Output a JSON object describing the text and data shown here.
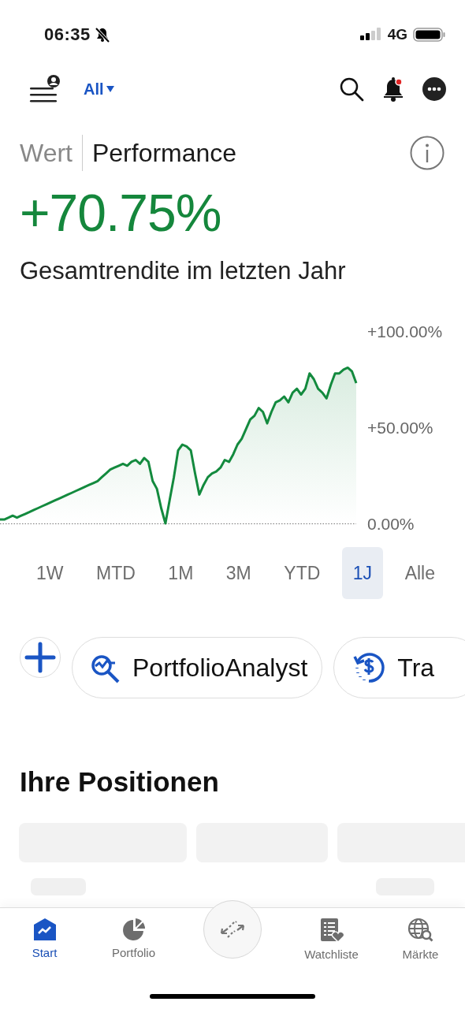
{
  "status_bar": {
    "time": "06:35",
    "network": "4G"
  },
  "header": {
    "account_filter": "All"
  },
  "view_tabs": [
    {
      "label": "Wert",
      "selected": false
    },
    {
      "label": "Performance",
      "selected": true
    }
  ],
  "performance": {
    "value": "+70.75%",
    "caption": "Gesamtrendite im letzten Jahr",
    "chart_data": {
      "type": "line",
      "ylim": [
        0,
        100
      ],
      "yticks": [
        {
          "value": 100,
          "label": "+100.00%"
        },
        {
          "value": 50,
          "label": "+50.00%"
        },
        {
          "value": 0,
          "label": "0.00%"
        }
      ],
      "series": [
        {
          "color": "#138a3e",
          "values": [
            2,
            2,
            3,
            4,
            3,
            4,
            5,
            6,
            7,
            8,
            9,
            10,
            11,
            12,
            13,
            14,
            15,
            16,
            17,
            18,
            19,
            20,
            21,
            22,
            24,
            26,
            28,
            29,
            30,
            31,
            30,
            32,
            33,
            31,
            34,
            32,
            22,
            18,
            8,
            0,
            12,
            24,
            38,
            41,
            40,
            38,
            26,
            15,
            20,
            24,
            26,
            27,
            29,
            33,
            32,
            36,
            41,
            44,
            49,
            54,
            56,
            60,
            58,
            52,
            58,
            63,
            64,
            66,
            63,
            68,
            70,
            67,
            70,
            78,
            75,
            70,
            68,
            65,
            72,
            78,
            78,
            80,
            81,
            79,
            73
          ]
        }
      ]
    }
  },
  "ranges": [
    {
      "label": "1W",
      "selected": false
    },
    {
      "label": "MTD",
      "selected": false
    },
    {
      "label": "1M",
      "selected": false
    },
    {
      "label": "3M",
      "selected": false
    },
    {
      "label": "YTD",
      "selected": false
    },
    {
      "label": "1J",
      "selected": true
    },
    {
      "label": "Alle",
      "selected": false
    }
  ],
  "shortcuts": [
    {
      "kind": "add"
    },
    {
      "kind": "analyst",
      "label": "PortfolioAnalyst"
    },
    {
      "kind": "money",
      "label": "Tra"
    }
  ],
  "positions": {
    "title": "Ihre Positionen"
  },
  "nav": [
    {
      "kind": "home",
      "label": "Start",
      "selected": true
    },
    {
      "kind": "pie",
      "label": "Portfolio",
      "selected": false
    },
    {
      "kind": "list",
      "label": "Watchliste",
      "selected": false
    },
    {
      "kind": "globe",
      "label": "Märkte",
      "selected": false
    }
  ]
}
